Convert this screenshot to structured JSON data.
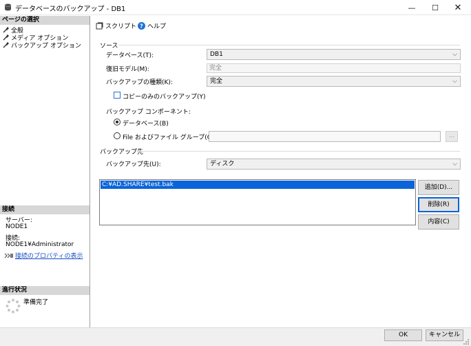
{
  "window": {
    "title": "データベースのバックアップ - DB1",
    "minimize": "—",
    "maximize": "☐",
    "close": "✕"
  },
  "left_pane": {
    "page_select_header": "ページの選択",
    "nav_items": [
      "全般",
      "メディア オプション",
      "バックアップ オプション"
    ],
    "connection_header": "接続",
    "server_label": "サーバー:",
    "server_value": "NODE1",
    "connection_label": "接続:",
    "connection_value": "NODE1¥Administrator",
    "connection_properties_link": "接続のプロパティの表示",
    "progress_header": "進行状況",
    "progress_status": "準備完了"
  },
  "toolbar": {
    "script_label": "スクリプト",
    "help_label": "ヘルプ"
  },
  "source": {
    "group_label": "ソース",
    "database_label": "データベース(T):",
    "database_value": "DB1",
    "recovery_model_label": "復旧モデル(M):",
    "recovery_model_value": "完全",
    "backup_type_label": "バックアップの種類(K):",
    "backup_type_value": "完全",
    "copy_only_label": "コピーのみのバックアップ(Y)",
    "copy_only_checked": false,
    "component_label": "バックアップ コンポーネント:",
    "component_database_label": "データベース(B)",
    "component_file_label": "File およびファイル グループ(G):",
    "file_browse_label": "...",
    "selected_component": "database"
  },
  "destination": {
    "group_label": "バックアップ先",
    "backup_to_label": "バックアップ先(U):",
    "backup_to_value": "ディスク",
    "paths": [
      "C:¥AD.SHARE¥test.bak"
    ],
    "add_button": "追加(D)...",
    "remove_button": "削除(R)",
    "contents_button": "内容(C)"
  },
  "footer": {
    "ok_button": "OK",
    "cancel_button": "キャンセル"
  },
  "colors": {
    "selection": "#0a64d8",
    "link": "#1a4fc2",
    "section_header_bg": "#d7d7d7",
    "help_icon": "#1e73d8"
  }
}
